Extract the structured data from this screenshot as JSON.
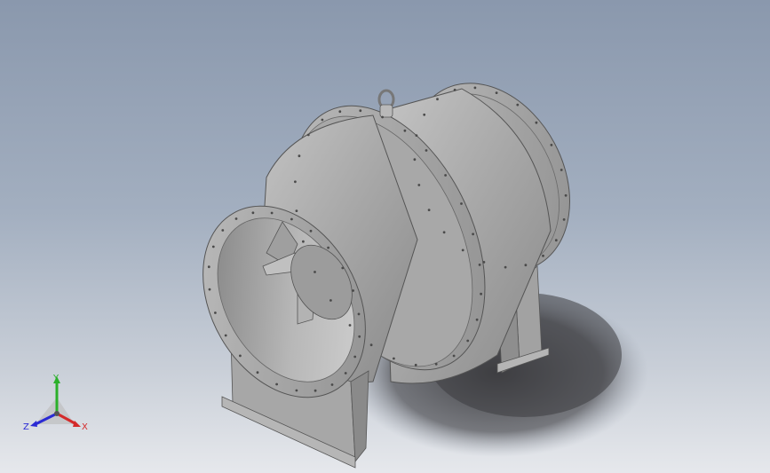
{
  "viewport": {
    "background_top": "#8a98ad",
    "background_bottom": "#e6e8ec",
    "model": {
      "part_colour": "#a9a9a9",
      "shadow_colour": "#3f3f42"
    }
  },
  "triad": {
    "x_label": "X",
    "y_label": "Y",
    "z_label": "Z",
    "x_colour": "#d42a2a",
    "y_colour": "#2bb02b",
    "z_colour": "#2a2ad4"
  }
}
